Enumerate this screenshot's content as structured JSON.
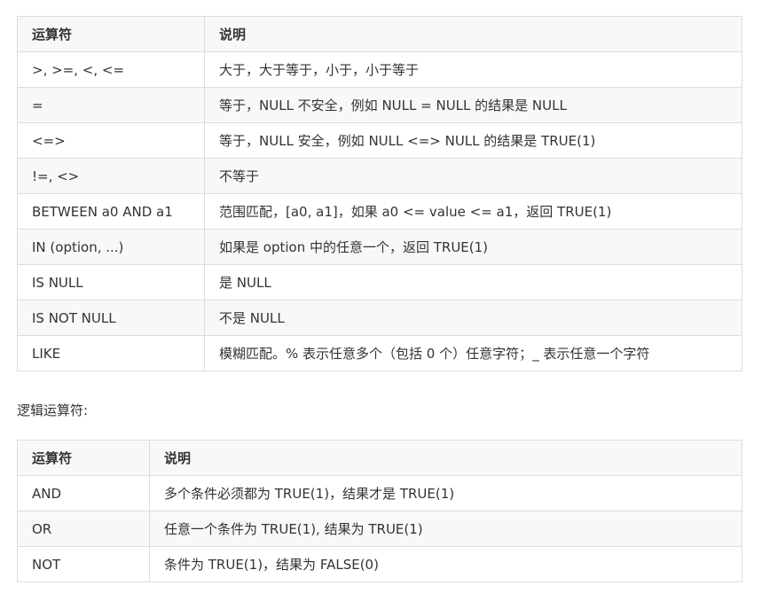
{
  "comparison_table": {
    "headers": [
      "运算符",
      "说明"
    ],
    "rows": [
      [
        ">, >=, <, <=",
        "大于，大于等于，小于，小于等于"
      ],
      [
        "=",
        "等于，NULL 不安全，例如 NULL = NULL 的结果是 NULL"
      ],
      [
        "<=>",
        "等于，NULL 安全，例如 NULL <=> NULL 的结果是 TRUE(1)"
      ],
      [
        "!=, <>",
        "不等于"
      ],
      [
        "BETWEEN a0 AND a1",
        "范围匹配，[a0, a1]，如果 a0 <= value <= a1，返回 TRUE(1)"
      ],
      [
        "IN (option, ...)",
        "如果是 option 中的任意一个，返回 TRUE(1)"
      ],
      [
        "IS NULL",
        "是 NULL"
      ],
      [
        "IS NOT NULL",
        "不是 NULL"
      ],
      [
        "LIKE",
        "模糊匹配。% 表示任意多个（包括 0 个）任意字符；_ 表示任意一个字符"
      ]
    ]
  },
  "logic_section_label": "逻辑运算符:",
  "logic_table": {
    "headers": [
      "运算符",
      "说明"
    ],
    "rows": [
      [
        "AND",
        "多个条件必须都为 TRUE(1)，结果才是 TRUE(1)"
      ],
      [
        "OR",
        "任意一个条件为 TRUE(1), 结果为 TRUE(1)"
      ],
      [
        "NOT",
        "条件为 TRUE(1)，结果为 FALSE(0)"
      ]
    ]
  }
}
